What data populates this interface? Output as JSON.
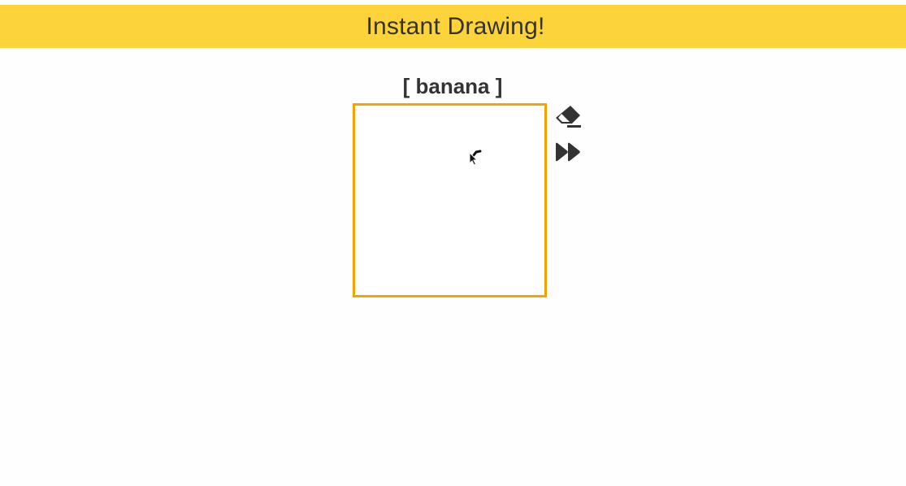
{
  "header": {
    "title": "Instant Drawing!"
  },
  "prompt": {
    "word": "[ banana ]"
  },
  "canvas": {
    "border_color": "#f5a300"
  },
  "toolbar": {
    "clear_icon": "eraser-icon",
    "skip_icon": "fast-forward-icon"
  },
  "colors": {
    "header_bg": "#fdd33c",
    "text": "#333333",
    "accent": "#f5a300"
  }
}
